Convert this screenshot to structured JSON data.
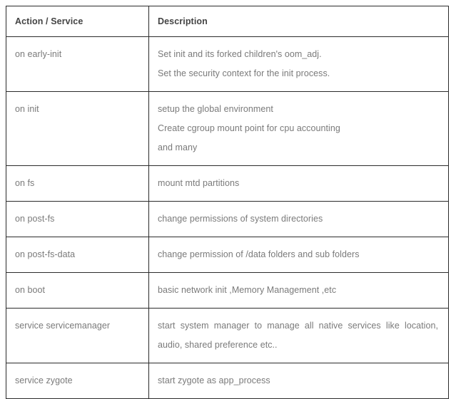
{
  "table": {
    "columns": [
      {
        "key": "action",
        "label": "Action / Service"
      },
      {
        "key": "description",
        "label": "Description"
      }
    ],
    "rows": [
      {
        "action": "on early-init",
        "lines": [
          "Set init and its forked children's oom_adj.",
          "Set the security context for the init process."
        ],
        "justify": false
      },
      {
        "action": "on init",
        "lines": [
          "setup the global environment",
          "Create cgroup mount point for cpu accounting",
          "and many"
        ],
        "justify": false
      },
      {
        "action": "on fs",
        "lines": [
          "mount mtd partitions"
        ],
        "justify": false
      },
      {
        "action": "on post-fs",
        "lines": [
          "change permissions of system directories"
        ],
        "justify": false
      },
      {
        "action": "on post-fs-data",
        "lines": [
          "change permission of /data folders and sub folders"
        ],
        "justify": false
      },
      {
        "action": "on boot",
        "lines": [
          "basic network init ,Memory Management ,etc"
        ],
        "justify": false
      },
      {
        "action": "service servicemanager",
        "lines": [
          "start system manager to manage all native services like location, audio, shared preference etc.."
        ],
        "justify": true
      },
      {
        "action": "service zygote",
        "lines": [
          "start zygote as app_process"
        ],
        "justify": false
      }
    ]
  },
  "style": {
    "border_color": "#2b2b2b",
    "header_text_color": "#444444",
    "body_text_color": "#7a7a7a",
    "background_color": "#ffffff"
  }
}
